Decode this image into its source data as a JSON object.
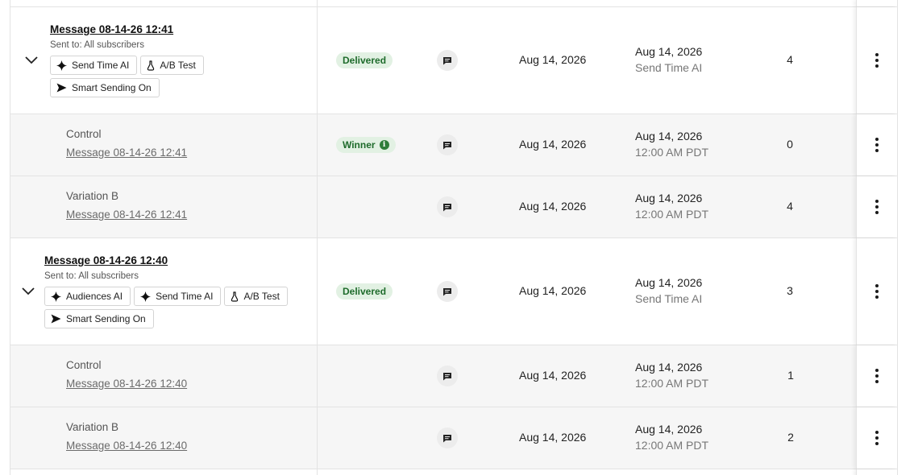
{
  "rows": [
    {
      "kind": "parent",
      "title": "Message 08-14-26 12:41",
      "sent_to": "Sent to: All subscribers",
      "tags": [
        {
          "label": "Send Time AI",
          "icon": "sparkle-icon"
        },
        {
          "label": "A/B Test",
          "icon": "flask-icon"
        },
        {
          "label": "Smart Sending On",
          "icon": "send-icon"
        }
      ],
      "status": "Delivered",
      "channel_icon": "message-icon",
      "date": "Aug 14, 2026",
      "send_date": "Aug 14, 2026",
      "send_detail": "Send Time AI",
      "count": "4"
    },
    {
      "kind": "variant",
      "name": "Control",
      "link": "Message 08-14-26 12:41",
      "status": "Winner",
      "channel_icon": "message-icon",
      "date": "Aug 14, 2026",
      "send_date": "Aug 14, 2026",
      "send_detail": "12:00 AM PDT",
      "count": "0"
    },
    {
      "kind": "variant",
      "name": "Variation B",
      "link": "Message 08-14-26 12:41",
      "status": "",
      "channel_icon": "message-icon",
      "date": "Aug 14, 2026",
      "send_date": "Aug 14, 2026",
      "send_detail": "12:00 AM PDT",
      "count": "4"
    },
    {
      "kind": "parent",
      "title": "Message 08-14-26 12:40",
      "sent_to": "Sent to: All subscribers",
      "tags": [
        {
          "label": "Audiences AI",
          "icon": "sparkle-icon"
        },
        {
          "label": "Send Time AI",
          "icon": "sparkle-icon"
        },
        {
          "label": "A/B Test",
          "icon": "flask-icon"
        },
        {
          "label": "Smart Sending On",
          "icon": "send-icon"
        }
      ],
      "status": "Delivered",
      "channel_icon": "message-icon",
      "date": "Aug 14, 2026",
      "send_date": "Aug 14, 2026",
      "send_detail": "Send Time AI",
      "count": "3"
    },
    {
      "kind": "variant",
      "name": "Control",
      "link": "Message 08-14-26 12:40",
      "status": "",
      "channel_icon": "message-icon",
      "date": "Aug 14, 2026",
      "send_date": "Aug 14, 2026",
      "send_detail": "12:00 AM PDT",
      "count": "1"
    },
    {
      "kind": "variant",
      "name": "Variation B",
      "link": "Message 08-14-26 12:40",
      "status": "",
      "channel_icon": "message-icon",
      "date": "Aug 14, 2026",
      "send_date": "Aug 14, 2026",
      "send_detail": "12:00 AM PDT",
      "count": "2"
    }
  ],
  "colors": {
    "badge_bg": "#e2f1e3",
    "badge_text": "#1e6b2b",
    "row_sub_bg": "#f6f6f6",
    "border": "#e3e3e3"
  }
}
